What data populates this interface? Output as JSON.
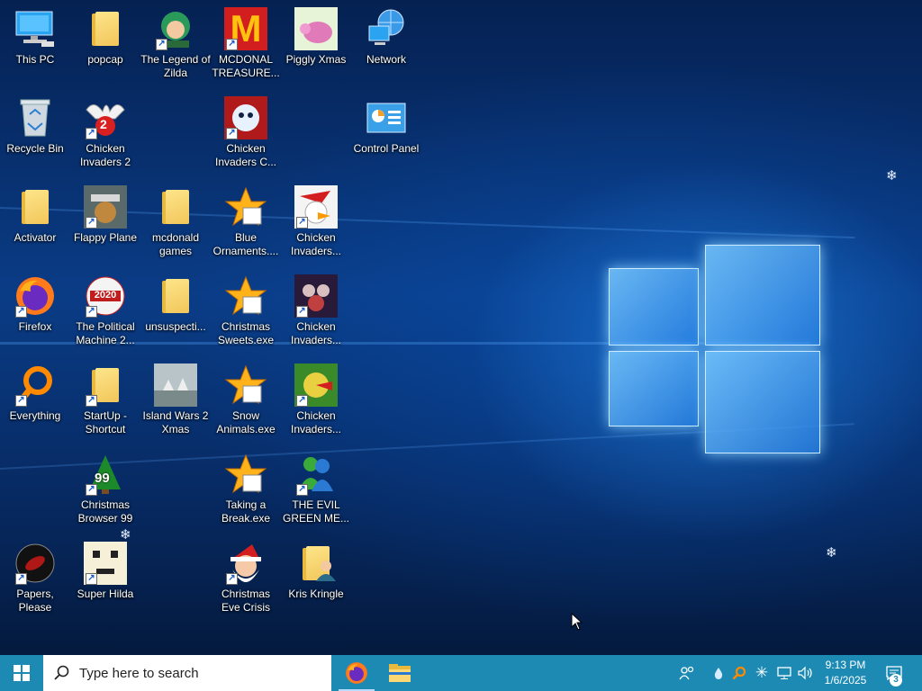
{
  "desktop": {
    "icons": [
      {
        "label": "This PC"
      },
      {
        "label": "popcap"
      },
      {
        "label": "The Legend of Zilda"
      },
      {
        "label": "MCDONAL TREASURE..."
      },
      {
        "label": "Piggly Xmas"
      },
      {
        "label": "Network"
      },
      {
        "label": "Recycle Bin"
      },
      {
        "label": "Chicken Invaders 2"
      },
      {
        "label": "Chicken Invaders C..."
      },
      {
        "label": "Control Panel"
      },
      {
        "label": "Activator"
      },
      {
        "label": "Flappy Plane"
      },
      {
        "label": "mcdonald games"
      },
      {
        "label": "Blue Ornaments...."
      },
      {
        "label": "Chicken Invaders..."
      },
      {
        "label": "Firefox"
      },
      {
        "label": "The Political Machine 2..."
      },
      {
        "label": "unsuspecti..."
      },
      {
        "label": "Christmas Sweets.exe"
      },
      {
        "label": "Chicken Invaders..."
      },
      {
        "label": "Everything"
      },
      {
        "label": "StartUp - Shortcut"
      },
      {
        "label": "Island Wars 2 Xmas"
      },
      {
        "label": "Snow Animals.exe"
      },
      {
        "label": "Chicken Invaders..."
      },
      {
        "label": "Christmas Browser 99"
      },
      {
        "label": "Taking a Break.exe"
      },
      {
        "label": "THE EVIL GREEN ME..."
      },
      {
        "label": "Papers, Please"
      },
      {
        "label": "Super Hilda"
      },
      {
        "label": "Christmas Eve Crisis"
      },
      {
        "label": "Kris Kringle"
      }
    ],
    "badges": {
      "mcdonalds": "M",
      "chicken2": "2",
      "political": "2020",
      "browser99": "99"
    }
  },
  "taskbar": {
    "search_placeholder": "Type here to search",
    "time": "9:13 PM",
    "date": "1/6/2025",
    "notification_count": "3"
  },
  "colors": {
    "taskbar": "#1c8ab3",
    "search_bg": "#ffffff",
    "wallpaper_dark": "#052152",
    "wallpaper_glow": "#2a8ceb"
  }
}
